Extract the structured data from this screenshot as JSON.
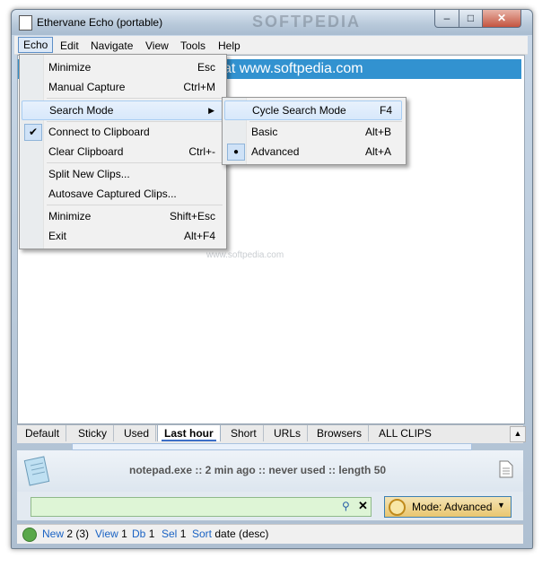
{
  "window": {
    "title": "Ethervane Echo (portable)",
    "watermark": "SOFTPEDIA",
    "watermark_small": "www.softpedia.com"
  },
  "caption_buttons": {
    "minimize": "–",
    "maximize": "□",
    "close": "✕"
  },
  "menubar": [
    "Echo",
    "Edit",
    "Navigate",
    "View",
    "Tools",
    "Help"
  ],
  "url_bar": {
    "text": "at www.softpedia.com"
  },
  "echo_menu": {
    "items": [
      {
        "label": "Minimize",
        "shortcut": "Esc"
      },
      {
        "label": "Manual Capture",
        "shortcut": "Ctrl+M"
      },
      {
        "label": "Search Mode",
        "shortcut": ""
      },
      {
        "label": "Connect to Clipboard",
        "shortcut": ""
      },
      {
        "label": "Clear Clipboard",
        "shortcut": "Ctrl+-"
      },
      {
        "label": "Split New Clips...",
        "shortcut": ""
      },
      {
        "label": "Autosave Captured Clips...",
        "shortcut": ""
      },
      {
        "label": "Minimize",
        "shortcut": "Shift+Esc"
      },
      {
        "label": "Exit",
        "shortcut": "Alt+F4"
      }
    ],
    "check_glyph": "✔"
  },
  "search_mode_menu": {
    "items": [
      {
        "label": "Cycle Search Mode",
        "shortcut": "F4"
      },
      {
        "label": "Basic",
        "shortcut": "Alt+B"
      },
      {
        "label": "Advanced",
        "shortcut": "Alt+A"
      }
    ],
    "radio_glyph": "●"
  },
  "tabs": [
    "Default",
    "Sticky",
    "Used",
    "Last hour",
    "Short",
    "URLs",
    "Browsers",
    "ALL CLIPS"
  ],
  "active_tab": "Last hour",
  "clip_info": "notepad.exe :: 2 min ago :: never used :: length 50",
  "search": {
    "value": "",
    "placeholder": ""
  },
  "mode_button": {
    "label": "Mode: Advanced"
  },
  "status": {
    "new_key": "New",
    "new_val": "2 (3)",
    "view_key": "View",
    "view_val": "1",
    "db_key": "Db",
    "db_val": "1",
    "sel_key": "Sel",
    "sel_val": "1",
    "sort_key": "Sort",
    "sort_val": "date (desc)"
  },
  "colors": {
    "accent": "#3292d0",
    "search_bg": "#def5d6",
    "mode_button": "#e9c66f",
    "status_key": "#1a63c4"
  }
}
